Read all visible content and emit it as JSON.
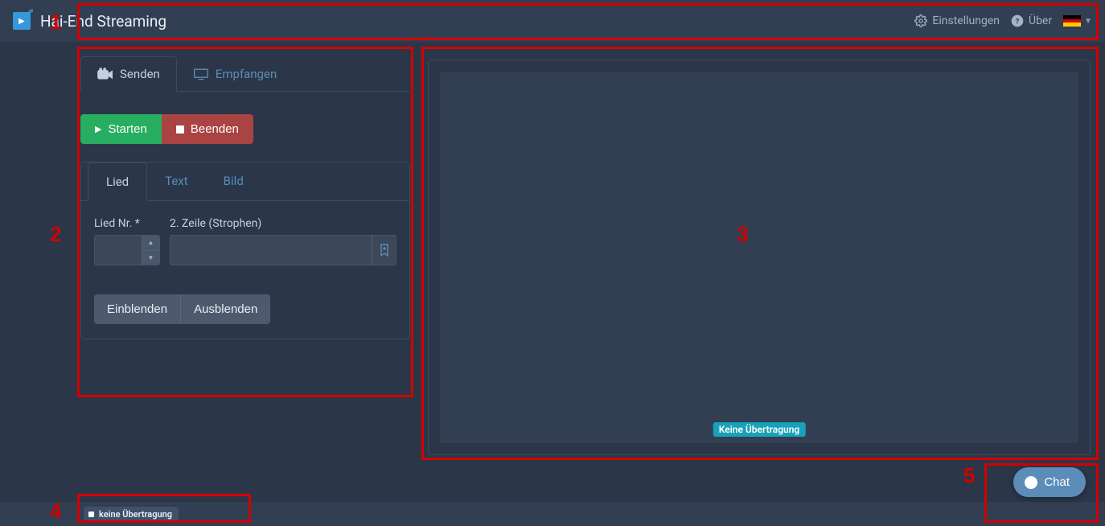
{
  "header": {
    "title": "Hai-End Streaming",
    "settings_label": "Einstellungen",
    "about_label": "Über",
    "language": "de"
  },
  "main_tabs": {
    "send": "Senden",
    "receive": "Empfangen"
  },
  "controls": {
    "start_label": "Starten",
    "stop_label": "Beenden"
  },
  "content_tabs": {
    "song": "Lied",
    "text": "Text",
    "image": "Bild"
  },
  "form": {
    "song_nr_label": "Lied Nr. *",
    "line2_label": "2. Zeile (Strophen)",
    "song_nr_value": "",
    "line2_value": ""
  },
  "fade": {
    "in_label": "Einblenden",
    "out_label": "Ausblenden"
  },
  "preview": {
    "no_transmission_badge": "Keine Übertragung"
  },
  "footer": {
    "status_text": "keine Übertragung"
  },
  "chat": {
    "label": "Chat"
  },
  "annotations": {
    "n1": "1",
    "n2": "2",
    "n3": "3",
    "n4": "4",
    "n5": "5"
  }
}
